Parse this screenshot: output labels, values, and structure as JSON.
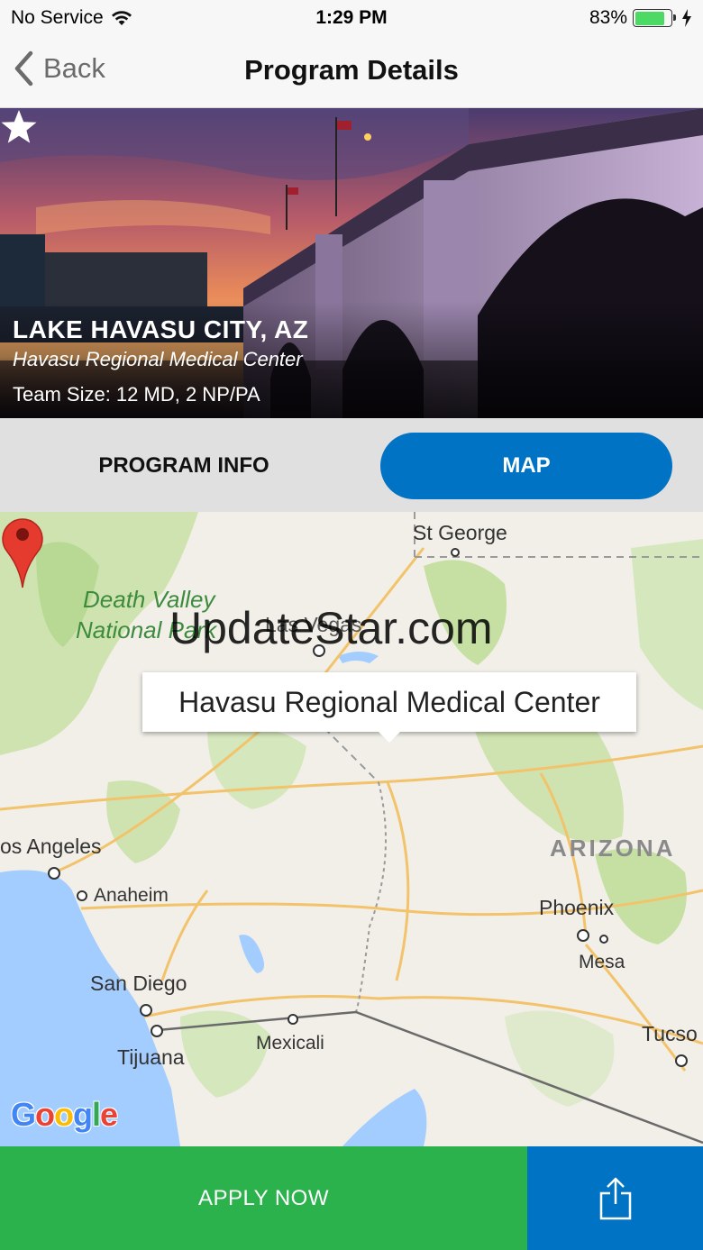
{
  "status_bar": {
    "carrier": "No Service",
    "time": "1:29 PM",
    "battery_percent": "83%",
    "battery_level": 0.83,
    "icons": [
      "wifi-icon",
      "battery-icon",
      "charging-bolt-icon"
    ]
  },
  "nav": {
    "back_label": "Back",
    "title": "Program Details"
  },
  "hero": {
    "city": "LAKE HAVASU CITY, AZ",
    "hospital": "Havasu Regional Medical Center",
    "team_size": "Team Size: 12 MD, 2 NP/PA",
    "favorite_icon": "star-icon"
  },
  "tabs": {
    "program_info_label": "PROGRAM INFO",
    "map_label": "MAP",
    "selected": "MAP"
  },
  "map": {
    "callout": "Havasu Regional Medical Center",
    "watermark": "UpdateStar.com",
    "attribution": "Google",
    "labels": {
      "st_george": "St George",
      "death_valley_1": "Death Valley",
      "death_valley_2": "National Park",
      "las_vegas": "Las Vegas",
      "los_angeles": "os Angeles",
      "anaheim": "Anaheim",
      "arizona": "ARIZONA",
      "phoenix": "Phoenix",
      "mesa": "Mesa",
      "san_diego": "San Diego",
      "tijuana": "Tijuana",
      "mexicali": "Mexicali",
      "tucson": "Tucso"
    }
  },
  "footer": {
    "apply_label": "APPLY NOW",
    "share_icon": "share-icon"
  },
  "colors": {
    "primary_blue": "#0073c4",
    "apply_green": "#2bb24c",
    "pin_red": "#e53b2f"
  }
}
